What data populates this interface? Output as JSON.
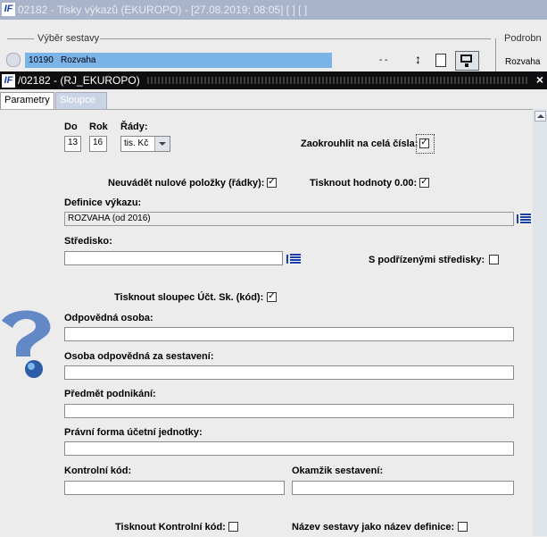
{
  "background_window": {
    "title": "02182 - Tisky výkazů (EKUROPO) - [27.08.2019; 08:05]  [ ]  [ ]",
    "group_left": "Výběr sestavy",
    "group_right": "Podrobn",
    "row_code": "10190",
    "row_name": "Rozvaha",
    "row_dashes": "-   -",
    "row_right": "Rozvaha"
  },
  "window": {
    "title": "/02182 - (RJ_EKUROPO)",
    "close_label": "×"
  },
  "tabs": [
    {
      "label": "Parametry",
      "active": true
    },
    {
      "label": "Sloupce",
      "active": false
    }
  ],
  "form": {
    "do_label": "Do",
    "do_value": "13",
    "rok_label": "Rok",
    "rok_value": "16",
    "rady_label": "Řády:",
    "rady_value": "tis. Kč",
    "zaokrouhlit_label": "Zaokrouhlit na celá čísla:",
    "zaokrouhlit_checked": true,
    "neuvadet_label": "Neuvádět nulové položky (řádky):",
    "neuvadet_checked": true,
    "tisknout_hodnoty_label": "Tisknout hodnoty 0.00:",
    "tisknout_hodnoty_checked": true,
    "definice_label": "Definice výkazu:",
    "definice_value": "ROZVAHA (od 2016)",
    "stredisko_label": "Středisko:",
    "stredisko_value": "",
    "podrizene_label": "S podřízenými středisky:",
    "podrizene_checked": false,
    "tisknout_sloupec_label": "Tisknout sloupec Účt. Sk. (kód):",
    "tisknout_sloupec_checked": true,
    "odpovedna_label": "Odpovědná osoba:",
    "odpovedna_value": "",
    "osoba_sestaveni_label": "Osoba odpovědná za sestavení:",
    "osoba_sestaveni_value": "",
    "predmet_label": "Předmět podnikání:",
    "predmet_value": "",
    "pravni_label": "Právní forma účetní jednotky:",
    "pravni_value": "",
    "kontrolni_label": "Kontrolní kód:",
    "kontrolni_value": "",
    "okamzik_label": "Okamžik sestavení:",
    "okamzik_value": "",
    "tisknout_kontrolni_label": "Tisknout Kontrolní kód:",
    "tisknout_kontrolni_checked": false,
    "nazev_sestavy_label": "Název sestavy jako název definice:",
    "nazev_sestavy_checked": false
  },
  "icons": {
    "app_logo": "app-logo-icon",
    "help": "help-question-icon",
    "list_picker": "list-picker-icon",
    "check_mark": "✓"
  },
  "colors": {
    "title_bar_bg": "#0e0e10",
    "selected_row": "#7ab4e6",
    "accent_blue": "#1a3fa8"
  }
}
